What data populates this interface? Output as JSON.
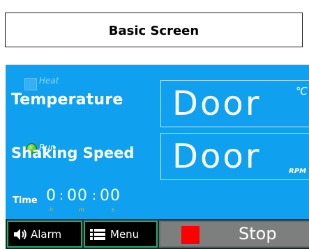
{
  "header": {
    "title": "Basic Screen"
  },
  "panel": {
    "heat_label": "Heat",
    "temperature_label": "Temperature",
    "temperature_value": "Door",
    "temperature_unit": "℃",
    "run_label": "Run",
    "speed_label": "Shaking Speed",
    "speed_value": "Door",
    "speed_unit": "RPM",
    "time_label": "Time",
    "time": {
      "hours": "0",
      "minutes": "00",
      "seconds": "00",
      "hours_unit": "h",
      "minutes_unit": "m",
      "seconds_unit": "s",
      "separator": ":"
    }
  },
  "controls": {
    "alarm_label": "Alarm",
    "menu_label": "Menu",
    "stop_label": "Stop"
  },
  "icons": {
    "alarm": "speaker-icon",
    "menu": "list-icon",
    "stop": "stop-square-icon",
    "run": "led-indicator-icon"
  },
  "colors": {
    "panel_bg": "#0fa0ef",
    "run_led": "#4fbf2a",
    "stop_square": "#ff0000",
    "time_unit": "#f5b400",
    "button_border": "#2fa56a"
  }
}
